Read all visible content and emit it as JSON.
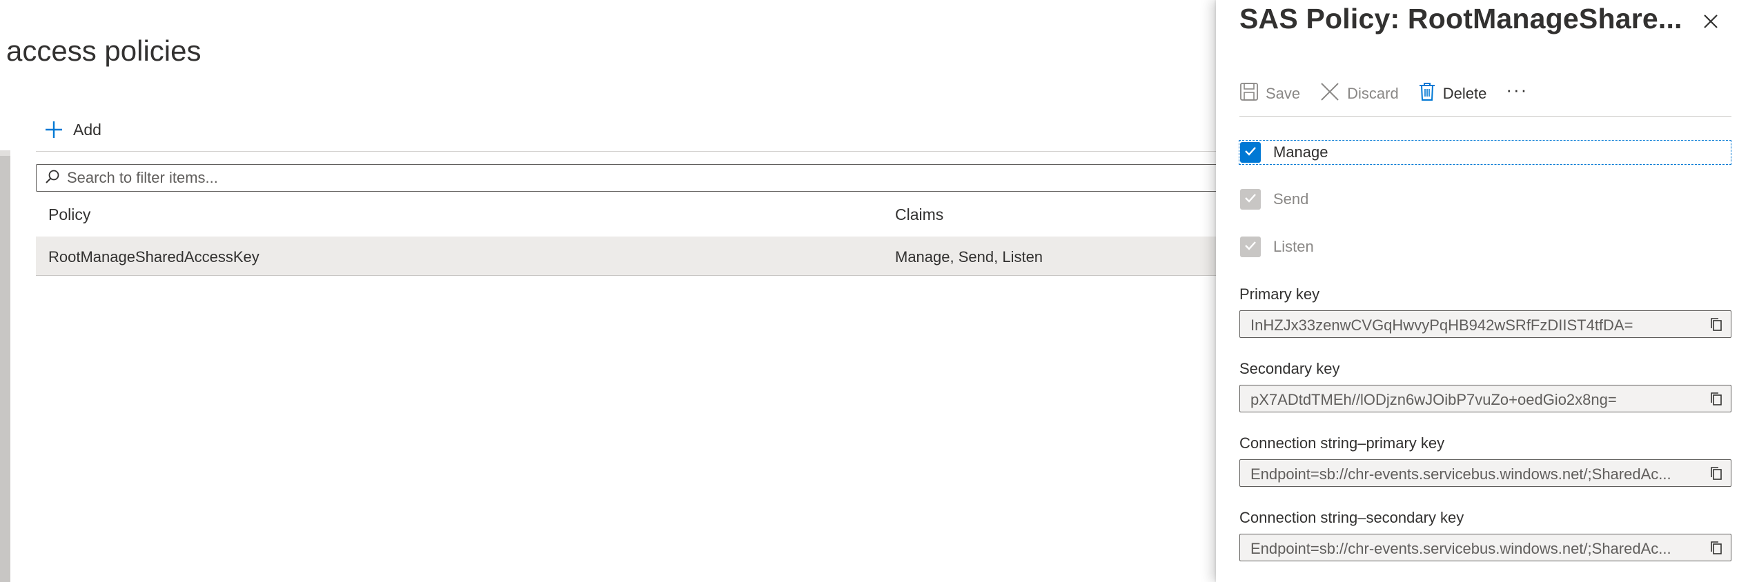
{
  "page": {
    "title": "d access policies"
  },
  "toolbar": {
    "add_label": "Add"
  },
  "search": {
    "placeholder": "Search to filter items..."
  },
  "table": {
    "columns": [
      "Policy",
      "Claims"
    ],
    "rows": [
      {
        "policy": "RootManageSharedAccessKey",
        "claims": "Manage, Send, Listen"
      }
    ]
  },
  "panel": {
    "title": "SAS Policy: RootManageShare...",
    "actions": {
      "save": "Save",
      "discard": "Discard",
      "delete": "Delete",
      "more": "···"
    },
    "claims": [
      {
        "label": "Manage",
        "checked": true,
        "disabled": false
      },
      {
        "label": "Send",
        "checked": true,
        "disabled": true
      },
      {
        "label": "Listen",
        "checked": true,
        "disabled": true
      }
    ],
    "fields": [
      {
        "label": "Primary key",
        "value": "InHZJx33zenwCVGqHwvyPqHB942wSRfFzDIIST4tfDA="
      },
      {
        "label": "Secondary key",
        "value": "pX7ADtdTMEh//lODjzn6wJOibP7vuZo+oedGio2x8ng="
      },
      {
        "label": "Connection string–primary key",
        "value": "Endpoint=sb://chr-events.servicebus.windows.net/;SharedAc..."
      },
      {
        "label": "Connection string–secondary key",
        "value": "Endpoint=sb://chr-events.servicebus.windows.net/;SharedAc..."
      }
    ]
  },
  "colors": {
    "accent": "#0078d4",
    "disabled": "#8a8886",
    "text": "#323130"
  },
  "icons": [
    "plus-icon",
    "search-icon",
    "close-icon",
    "save-icon",
    "discard-icon",
    "delete-icon",
    "checkmark-icon",
    "copy-icon"
  ]
}
